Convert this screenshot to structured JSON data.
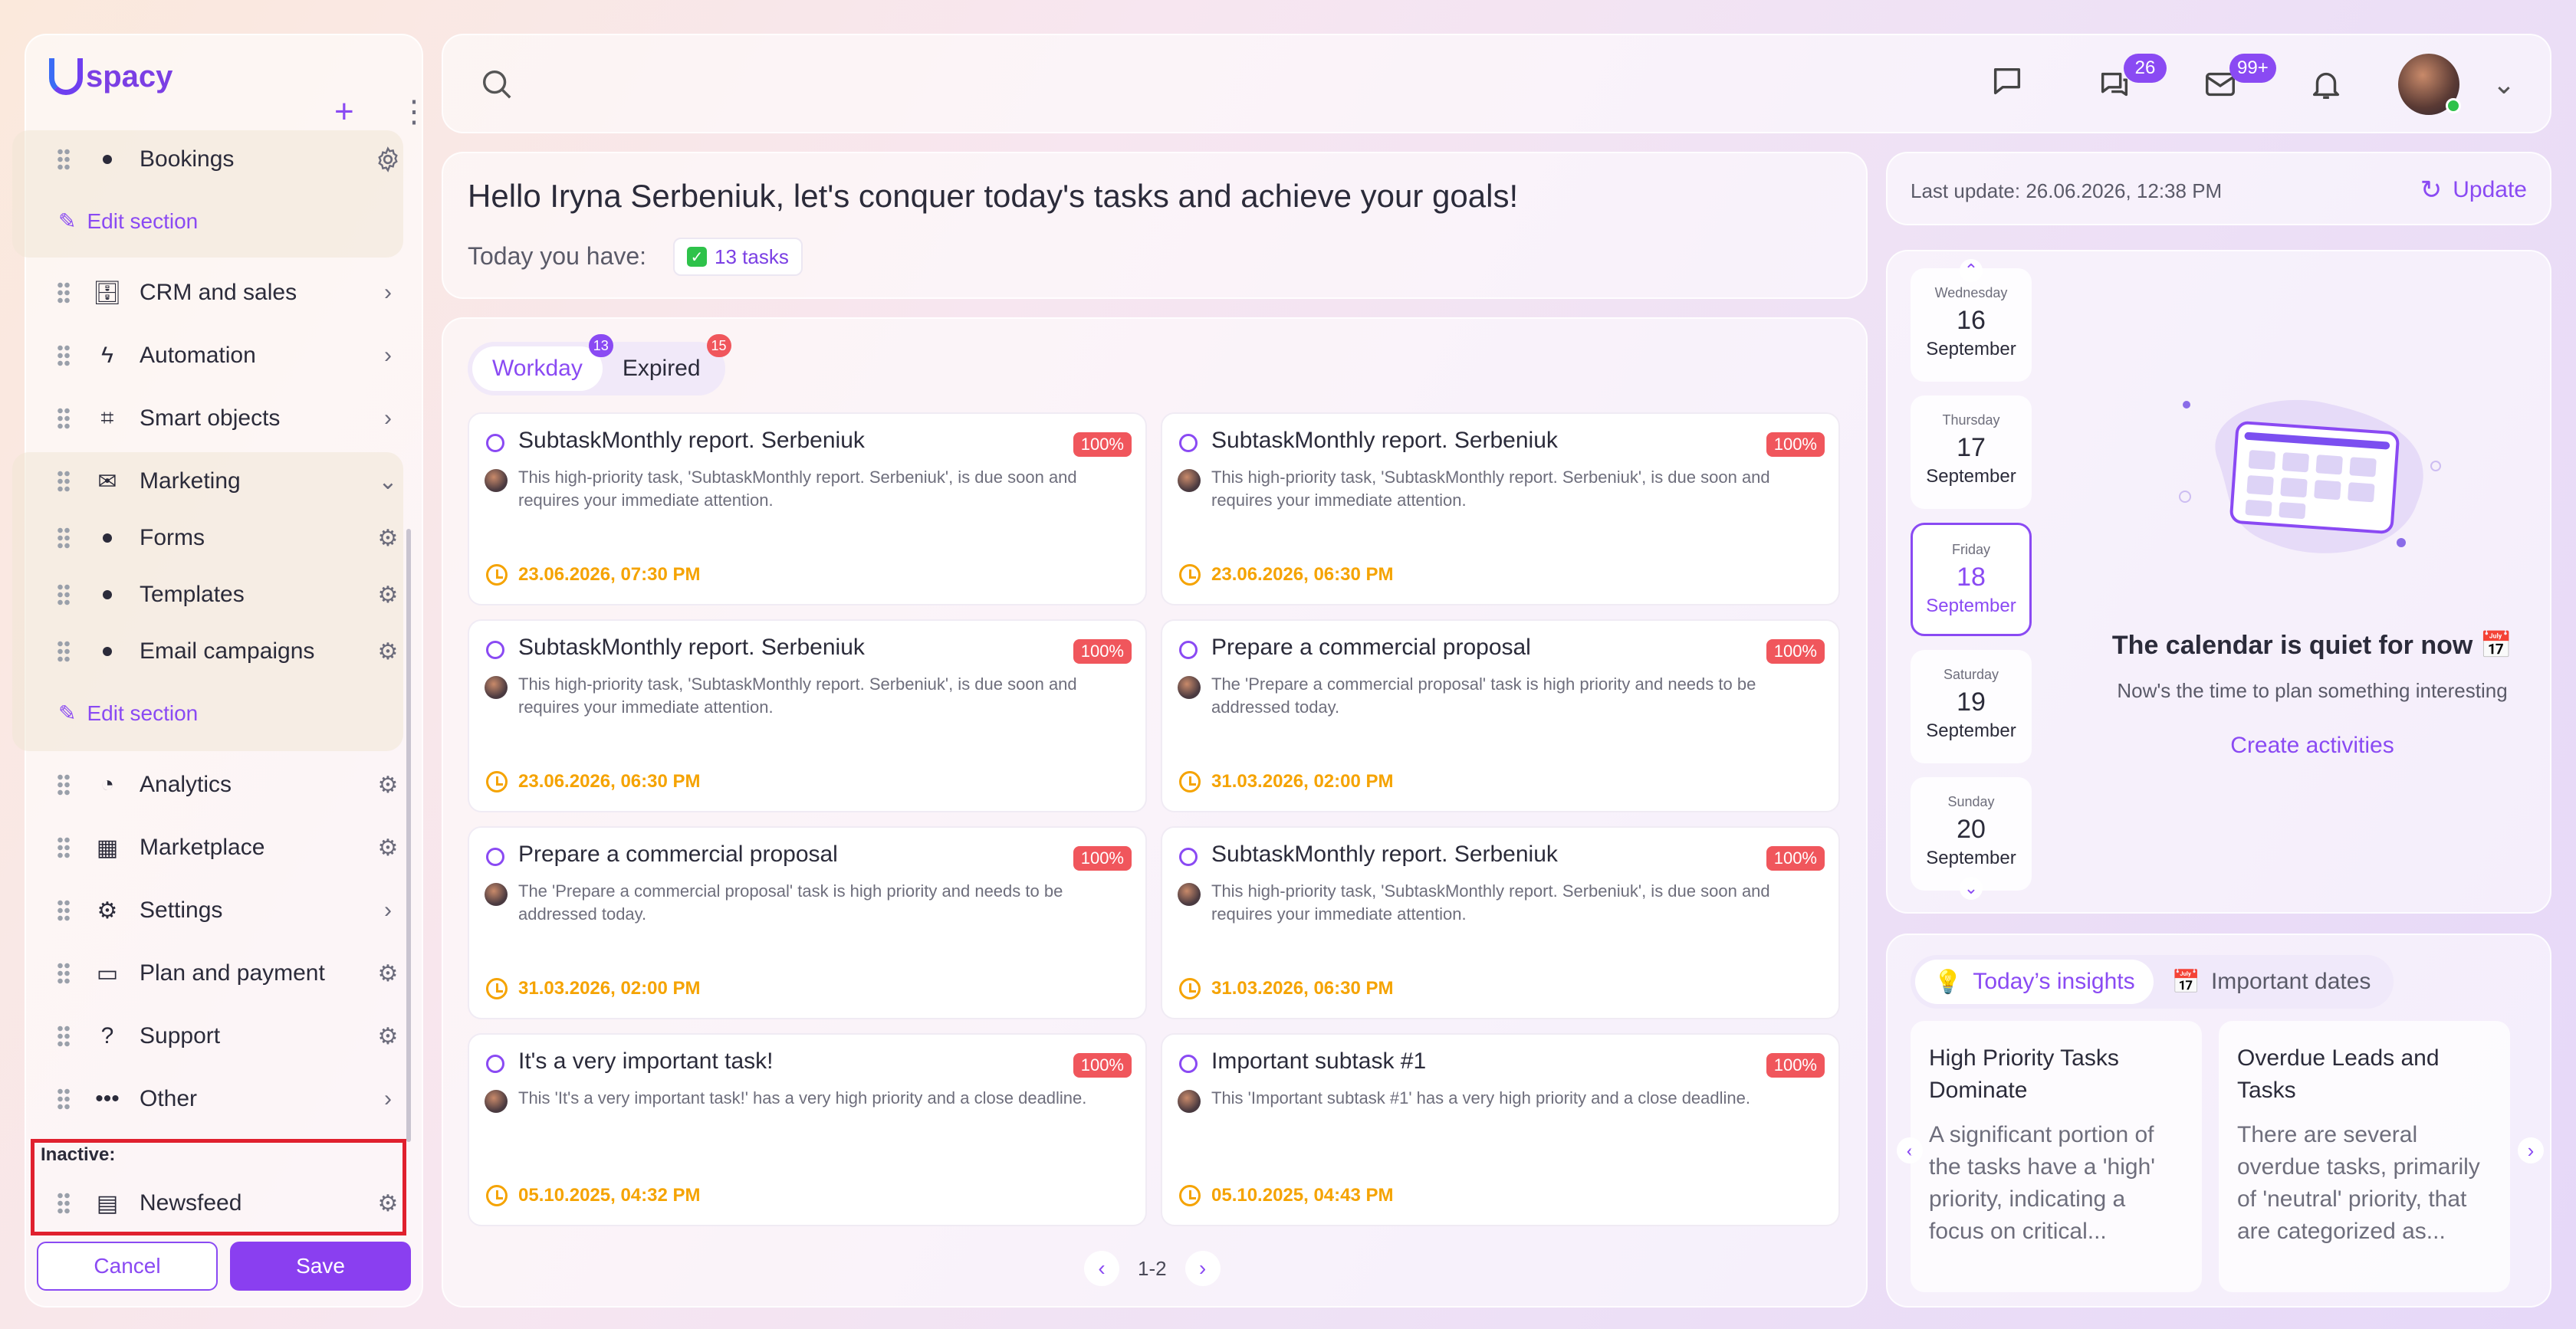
{
  "sidebar": {
    "brand": "spacy",
    "items": {
      "bookings": "Bookings",
      "edit_section": "Edit section",
      "crm": "CRM and sales",
      "automation": "Automation",
      "smart_objects": "Smart objects",
      "marketing": "Marketing",
      "forms": "Forms",
      "templates": "Templates",
      "email_campaigns": "Email campaigns",
      "analytics": "Analytics",
      "marketplace": "Marketplace",
      "settings": "Settings",
      "plan": "Plan and payment",
      "support": "Support",
      "other": "Other",
      "newsfeed": "Newsfeed"
    },
    "inactive_label": "Inactive:",
    "cancel": "Cancel",
    "save": "Save"
  },
  "topbar": {
    "chat_badge": "26",
    "mail_badge": "99+"
  },
  "greeting": {
    "title": "Hello Iryna Serbeniuk, let's conquer today's tasks and achieve your goals!",
    "today_label": "Today you have:",
    "tasks_pill": "13 tasks"
  },
  "tasks": {
    "tabs": [
      {
        "label": "Workday",
        "badge": "13"
      },
      {
        "label": "Expired",
        "badge": "15"
      }
    ],
    "cards": [
      {
        "title": "SubtaskMonthly report. Serbeniuk",
        "pct": "100%",
        "desc": "This high-priority task, 'SubtaskMonthly report. Serbeniuk', is due soon and requires your immediate attention.",
        "date": "23.06.2026, 07:30 PM"
      },
      {
        "title": "SubtaskMonthly report. Serbeniuk",
        "pct": "100%",
        "desc": "This high-priority task, 'SubtaskMonthly report. Serbeniuk', is due soon and requires your immediate attention.",
        "date": "23.06.2026, 06:30 PM"
      },
      {
        "title": "SubtaskMonthly report. Serbeniuk",
        "pct": "100%",
        "desc": "This high-priority task, 'SubtaskMonthly report. Serbeniuk', is due soon and requires your immediate attention.",
        "date": "23.06.2026, 06:30 PM"
      },
      {
        "title": "Prepare a commercial proposal",
        "pct": "100%",
        "desc": "The 'Prepare a commercial proposal' task is high priority and needs to be addressed today.",
        "date": "31.03.2026, 02:00 PM"
      },
      {
        "title": "Prepare a commercial proposal",
        "pct": "100%",
        "desc": "The 'Prepare a commercial proposal' task is high priority and needs to be addressed today.",
        "date": "31.03.2026, 02:00 PM"
      },
      {
        "title": "SubtaskMonthly report. Serbeniuk",
        "pct": "100%",
        "desc": "This high-priority task, 'SubtaskMonthly report. Serbeniuk', is due soon and requires your immediate attention.",
        "date": "31.03.2026, 06:30 PM"
      },
      {
        "title": "It's a very important task!",
        "pct": "100%",
        "desc": "This 'It's a very important task!' has a very high priority and a close deadline.",
        "date": "05.10.2025, 04:32 PM"
      },
      {
        "title": "Important subtask #1",
        "pct": "100%",
        "desc": "This 'Important subtask #1' has a very high priority and a close deadline.",
        "date": "05.10.2025, 04:43 PM"
      }
    ],
    "pager": "1-2"
  },
  "update": {
    "last": "Last update: 26.06.2026, 12:38 PM",
    "button": "Update"
  },
  "calendar": {
    "days": [
      {
        "weekday": "Wednesday",
        "day": "16",
        "month": "September"
      },
      {
        "weekday": "Thursday",
        "day": "17",
        "month": "September"
      },
      {
        "weekday": "Friday",
        "day": "18",
        "month": "September"
      },
      {
        "weekday": "Saturday",
        "day": "19",
        "month": "September"
      },
      {
        "weekday": "Sunday",
        "day": "20",
        "month": "September"
      }
    ],
    "empty_title": "The calendar is quiet for now 📅",
    "empty_sub": "Now's the time to plan something interesting",
    "create": "Create activities"
  },
  "insights": {
    "tab_today": "Today’s insights",
    "tab_dates": "Important dates",
    "cards": [
      {
        "title": "High Priority Tasks Dominate",
        "body": "A significant portion of the tasks have a 'high' priority, indicating a focus on critical..."
      },
      {
        "title": "Overdue Leads and Tasks",
        "body": "There are several overdue tasks, primarily of 'neutral' priority, that are categorized as..."
      }
    ]
  }
}
